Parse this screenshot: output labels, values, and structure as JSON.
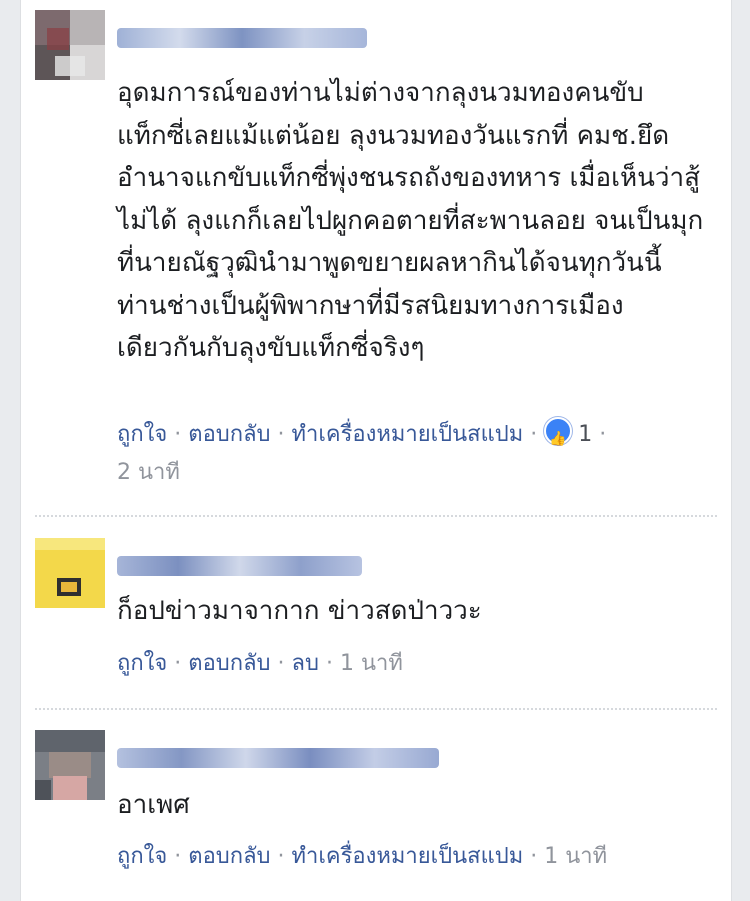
{
  "comments": [
    {
      "text": "อุดมการณ์ของท่านไม่ต่างจากลุงนวมทองคนขับแท็กซี่เลยแม้แต่น้อย ลุงนวมทองวันแรกที่ คมช.ยึดอำนาจแกขับแท็กซี่พุ่งชนรถถังของทหาร เมื่อเห็นว่าสู้ไม่ได้ ลุงแกก็เลยไปผูกคอตายที่สะพานลอย จนเป็นมุกที่นายณัฐวุฒินำมาพูดขยายผลหากินได้จนทุกวันนี้ ท่านช่างเป็นผู้พิพากษาที่มีรสนิยมทางการเมืองเดียวกันกับลุงขับแท็กซี่จริงๆ",
      "actions": {
        "like": "ถูกใจ",
        "reply": "ตอบกลับ",
        "third": "ทำเครื่องหมายเป็นสแปม",
        "reaction_count": "1",
        "time": "2 นาที"
      }
    },
    {
      "text": "ก็อปข่าวมาจากาก ข่าวสดป่าววะ",
      "actions": {
        "like": "ถูกใจ",
        "reply": "ตอบกลับ",
        "third": "ลบ",
        "time": "1 นาที"
      }
    },
    {
      "text": "อาเพศ",
      "actions": {
        "like": "ถูกใจ",
        "reply": "ตอบกลับ",
        "third": "ทำเครื่องหมายเป็นสแปม",
        "time": "1 นาที"
      }
    }
  ],
  "separator": "·",
  "colors": {
    "link": "#385898",
    "text": "#1c1e21",
    "meta": "#90949c",
    "like_badge": "#3b82f6"
  }
}
